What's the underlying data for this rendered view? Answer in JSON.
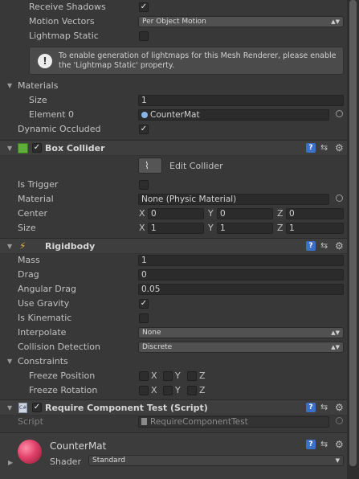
{
  "mesh_renderer": {
    "receive_shadows_label": "Receive Shadows",
    "motion_vectors_label": "Motion Vectors",
    "motion_vectors_value": "Per Object Motion",
    "lightmap_static_label": "Lightmap Static",
    "info_text": "To enable generation of lightmaps for this Mesh Renderer, please enable the 'Lightmap Static' property.",
    "materials_label": "Materials",
    "size_label": "Size",
    "size_value": "1",
    "element0_label": "Element 0",
    "element0_value": "CounterMat",
    "dynamic_occluded_label": "Dynamic Occluded"
  },
  "box_collider": {
    "title": "Box Collider",
    "edit_collider_label": "Edit Collider",
    "is_trigger_label": "Is Trigger",
    "material_label": "Material",
    "material_value": "None (Physic Material)",
    "center_label": "Center",
    "center": {
      "x": "0",
      "y": "0",
      "z": "0"
    },
    "size_label": "Size",
    "size": {
      "x": "1",
      "y": "1",
      "z": "1"
    }
  },
  "rigidbody": {
    "title": "Rigidbody",
    "mass_label": "Mass",
    "mass_value": "1",
    "drag_label": "Drag",
    "drag_value": "0",
    "angular_drag_label": "Angular Drag",
    "angular_drag_value": "0.05",
    "use_gravity_label": "Use Gravity",
    "is_kinematic_label": "Is Kinematic",
    "interpolate_label": "Interpolate",
    "interpolate_value": "None",
    "collision_detection_label": "Collision Detection",
    "collision_detection_value": "Discrete",
    "constraints_label": "Constraints",
    "freeze_position_label": "Freeze Position",
    "freeze_rotation_label": "Freeze Rotation",
    "axis_x": "X",
    "axis_y": "Y",
    "axis_z": "Z"
  },
  "script_component": {
    "title": "Require Component Test (Script)",
    "script_label": "Script",
    "script_value": "RequireComponentTest"
  },
  "material": {
    "name": "CounterMat",
    "shader_label": "Shader",
    "shader_value": "Standard"
  },
  "xyz": {
    "x": "X",
    "y": "Y",
    "z": "Z"
  },
  "icons": {
    "help": "?",
    "check": "✓"
  },
  "colors": {
    "accent_blue": "#3c6fc7",
    "material_sphere": "#e0406a",
    "box_green": "#5fae3a"
  }
}
